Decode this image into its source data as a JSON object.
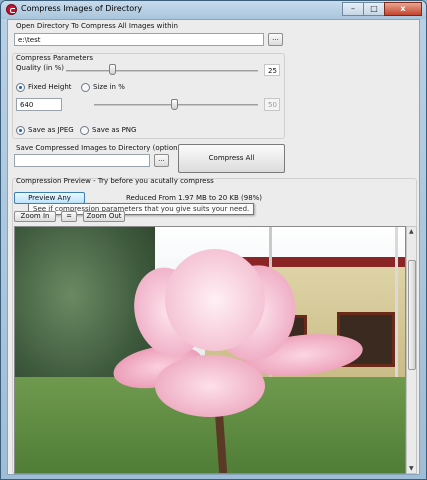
{
  "window": {
    "title": "Compress Images of Directory",
    "minimize_glyph": "–",
    "maximize_glyph": "□",
    "close_glyph": "x"
  },
  "open_dir": {
    "label": "Open Directory To Compress All Images within",
    "value": "e:\\test",
    "browse_label": "..."
  },
  "params": {
    "legend": "Compress Parameters",
    "quality_label": "Quality (in %)",
    "quality_value": "25",
    "quality_percent": 25,
    "fixed_height_label": "Fixed Height",
    "fixed_height_selected": true,
    "size_percent_label": "Size in %",
    "height_value": "640",
    "size_percent_value": "50",
    "size_percent_level": 50,
    "save_jpeg_label": "Save as JPEG",
    "save_jpeg_selected": true,
    "save_png_label": "Save as PNG"
  },
  "save_dir": {
    "label": "Save Compressed Images to Directory (optional)",
    "value": "",
    "browse_label": "...",
    "compress_all_label": "Compress All"
  },
  "preview": {
    "legend": "Compression Preview - Try before you acutally compress",
    "preview_any_label": "Preview Any",
    "reduced_text": "Reduced From 1.97 MB to 20 KB (98%)",
    "tooltip": "See if compression parameters that you give suits your need.",
    "zoom_in_label": "Zoom In",
    "reset_label": "=",
    "zoom_out_label": "Zoom Out"
  },
  "scrollbar": {
    "up_glyph": "▲",
    "down_glyph": "▼"
  }
}
